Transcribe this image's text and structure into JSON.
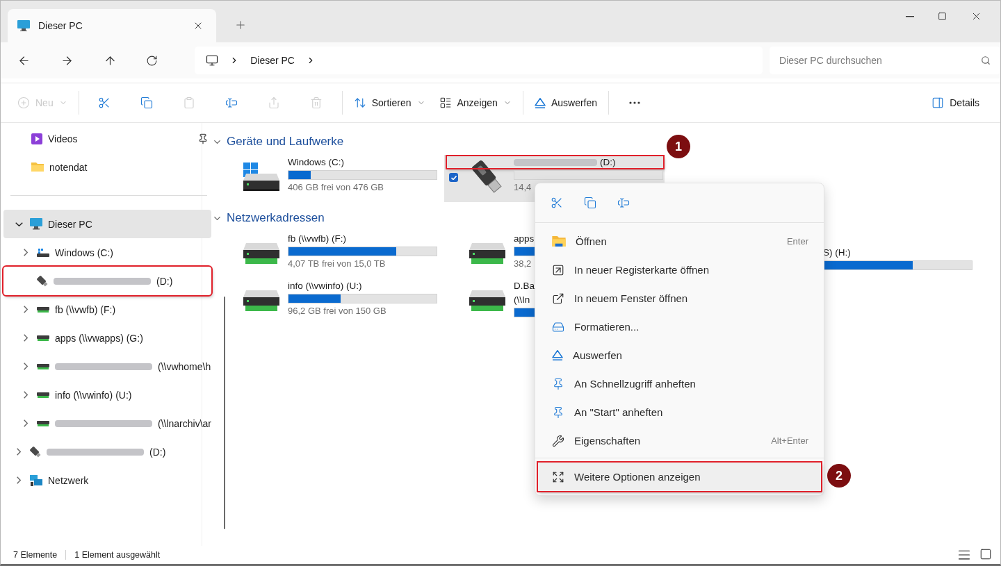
{
  "tab": {
    "title": "Dieser PC",
    "selected": true
  },
  "nav": {
    "breadcrumb": [
      "Dieser PC"
    ],
    "search": {
      "placeholder": "Dieser PC durchsuchen"
    }
  },
  "toolbar": [
    {
      "kind": "text",
      "label": "Neu",
      "disabled": true,
      "dropdown": true
    },
    {
      "kind": "separator"
    },
    {
      "kind": "icon",
      "disabled": false
    },
    {
      "kind": "icon",
      "disabled": false
    },
    {
      "kind": "icon",
      "disabled": true
    },
    {
      "kind": "icon",
      "disabled": false
    },
    {
      "kind": "icon",
      "disabled": true
    },
    {
      "kind": "icon",
      "disabled": true
    },
    {
      "kind": "separator"
    },
    {
      "kind": "text",
      "label": "Sortieren",
      "disabled": false,
      "dropdown": true
    },
    {
      "kind": "text",
      "label": "Anzeigen",
      "disabled": false,
      "dropdown": true
    },
    {
      "kind": "separator"
    },
    {
      "kind": "text",
      "label": "Auswerfen",
      "disabled": false,
      "dropdown": false
    },
    {
      "kind": "separator"
    },
    {
      "kind": "icon",
      "disabled": false
    }
  ],
  "details_button": {
    "label": "Details"
  },
  "sidebar": {
    "quick_access": [
      {
        "label": "Videos",
        "kind": "video",
        "pinned": true
      },
      {
        "label": "notendat",
        "kind": "folder",
        "pinned": false
      }
    ],
    "tree": [
      {
        "label": "Dieser PC",
        "kind": "pc",
        "expandable": true,
        "expanded": true,
        "selected": true,
        "redacted": false,
        "highlighted": false,
        "children": [
          {
            "label": "Windows (C:)",
            "kind": "windows-drive",
            "expandable": true,
            "selected": false,
            "redacted": false,
            "highlighted": false
          },
          {
            "label": "(D:)",
            "kind": "usb",
            "expandable": false,
            "selected": false,
            "redacted": true,
            "highlighted": true
          },
          {
            "label": "fb (\\\\vwfb) (F:)",
            "kind": "net-drive",
            "expandable": true,
            "selected": false,
            "redacted": false,
            "highlighted": false
          },
          {
            "label": "apps (\\\\vwapps) (G:)",
            "kind": "net-drive",
            "expandable": true,
            "selected": false,
            "redacted": false,
            "highlighted": false
          },
          {
            "label": "(\\\\vwhome\\h",
            "kind": "net-drive",
            "expandable": true,
            "selected": false,
            "redacted": true,
            "highlighted": false
          },
          {
            "label": "info (\\\\vwinfo) (U:)",
            "kind": "net-drive",
            "expandable": true,
            "selected": false,
            "redacted": false,
            "highlighted": false
          },
          {
            "label": "(\\\\lnarchiv\\ar",
            "kind": "net-drive",
            "expandable": true,
            "selected": false,
            "redacted": true,
            "highlighted": false
          }
        ]
      },
      {
        "label": "(D:)",
        "kind": "usb",
        "expandable": true,
        "selected": false,
        "redacted": true,
        "highlighted": false
      },
      {
        "label": "Netzwerk",
        "kind": "network",
        "expandable": true,
        "selected": false,
        "redacted": false,
        "highlighted": false
      }
    ]
  },
  "content": {
    "sections": [
      {
        "title": "Geräte und Laufwerke",
        "expanded": true,
        "drives": [
          {
            "name_lines": [
              "Windows (C:)"
            ],
            "kind": "windows-drive",
            "level": 0.15,
            "free": "406 GB frei von 476 GB",
            "selected": false,
            "redacted": false,
            "highlighted": false,
            "name_covered": false
          },
          {
            "name_lines": [
              "(D:)"
            ],
            "kind": "usb",
            "level": 0,
            "free": "14,4",
            "selected": true,
            "redacted": true,
            "highlighted": true,
            "name_covered": false,
            "callout": "1"
          }
        ]
      },
      {
        "title": "Netzwerkadressen",
        "expanded": true,
        "drives": [
          {
            "name_lines": [
              "fb (\\\\vwfb) (F:)"
            ],
            "kind": "net-drive",
            "level": 0.73,
            "free": "4,07 TB frei von 15,0 TB",
            "selected": false,
            "redacted": false,
            "highlighted": false,
            "name_covered": false
          },
          {
            "name_lines": [
              "apps"
            ],
            "kind": "net-drive",
            "level": 0.6,
            "free": "38,2",
            "selected": false,
            "redacted": false,
            "highlighted": false,
            "name_covered": false
          },
          {
            "name_lines": [
              "S) (H:)"
            ],
            "kind": "covered",
            "level": 0.6,
            "selected": false,
            "redacted": false,
            "highlighted": false,
            "name_covered": true
          },
          {
            "name_lines": [
              "info (\\\\vwinfo) (U:)"
            ],
            "kind": "net-drive",
            "level": 0.35,
            "free": "96,2 GB frei von 150 GB",
            "selected": false,
            "redacted": false,
            "highlighted": false,
            "name_covered": false
          },
          {
            "name_lines": [
              "D.Ba",
              "(\\\\In"
            ],
            "kind": "net-drive",
            "level": 0.6,
            "selected": false,
            "redacted": false,
            "highlighted": false,
            "name_covered": false
          }
        ]
      }
    ]
  },
  "context_menu": {
    "items": [
      {
        "label": "Öffnen",
        "shortcut": "Enter"
      },
      {
        "label": "In neuer Registerkarte öffnen"
      },
      {
        "label": "In neuem Fenster öffnen"
      },
      {
        "label": "Formatieren..."
      },
      {
        "label": "Auswerfen"
      },
      {
        "label": "An Schnellzugriff anheften"
      },
      {
        "label": "An \"Start\" anheften"
      },
      {
        "label": "Eigenschaften",
        "shortcut": "Alt+Enter"
      }
    ],
    "footer_item": {
      "label": "Weitere Optionen anzeigen",
      "highlighted": true,
      "callout": "2"
    }
  },
  "status_bar": {
    "count": "7 Elemente",
    "selection": "1 Element ausgewählt"
  }
}
